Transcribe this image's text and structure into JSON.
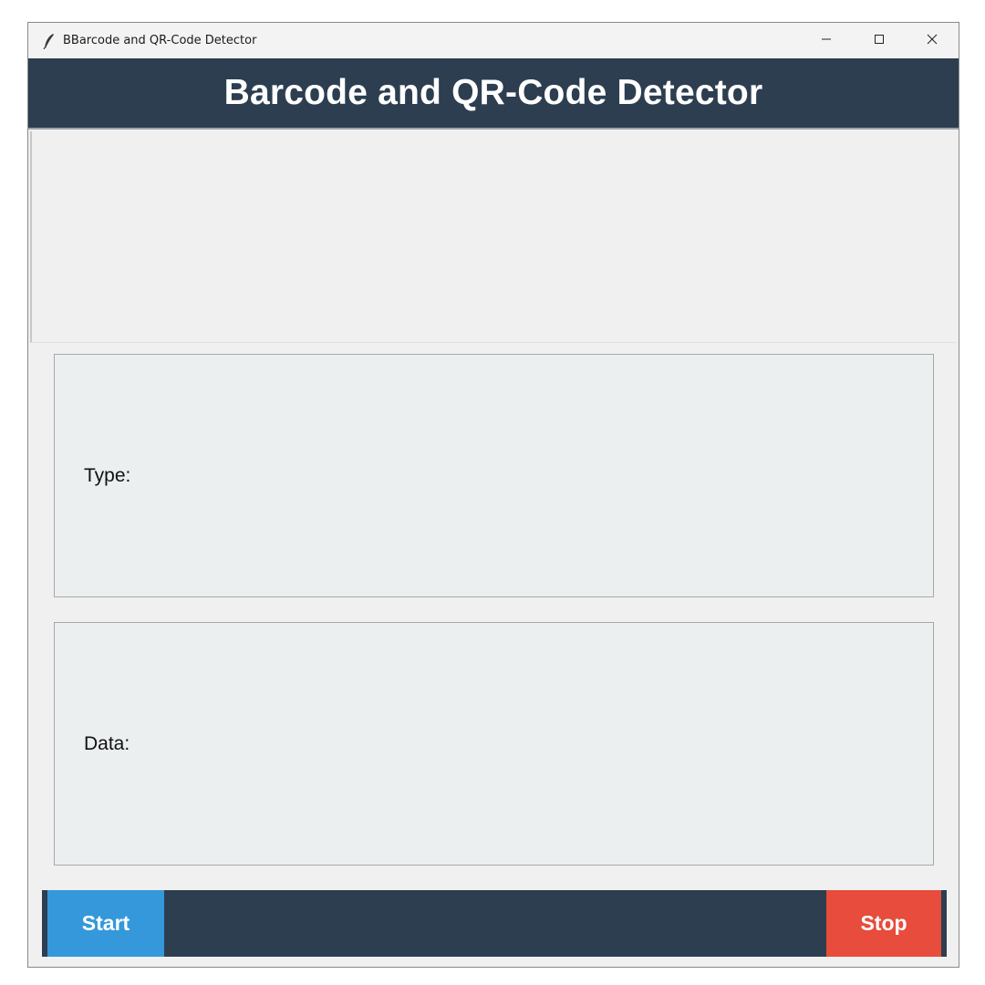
{
  "window": {
    "title": "BBarcode and QR-Code Detector",
    "controls": {
      "minimize_icon": "minimize-icon",
      "maximize_icon": "maximize-icon",
      "close_icon": "close-icon"
    }
  },
  "header": {
    "title": "Barcode and QR-Code Detector",
    "background": "#2c3e50"
  },
  "panels": {
    "type": {
      "label": "Type:",
      "value": ""
    },
    "data": {
      "label": "Data:",
      "value": ""
    }
  },
  "controls": {
    "start_label": "Start",
    "stop_label": "Stop",
    "start_color": "#3498db",
    "stop_color": "#e74c3c",
    "bar_color": "#2c3e50"
  }
}
